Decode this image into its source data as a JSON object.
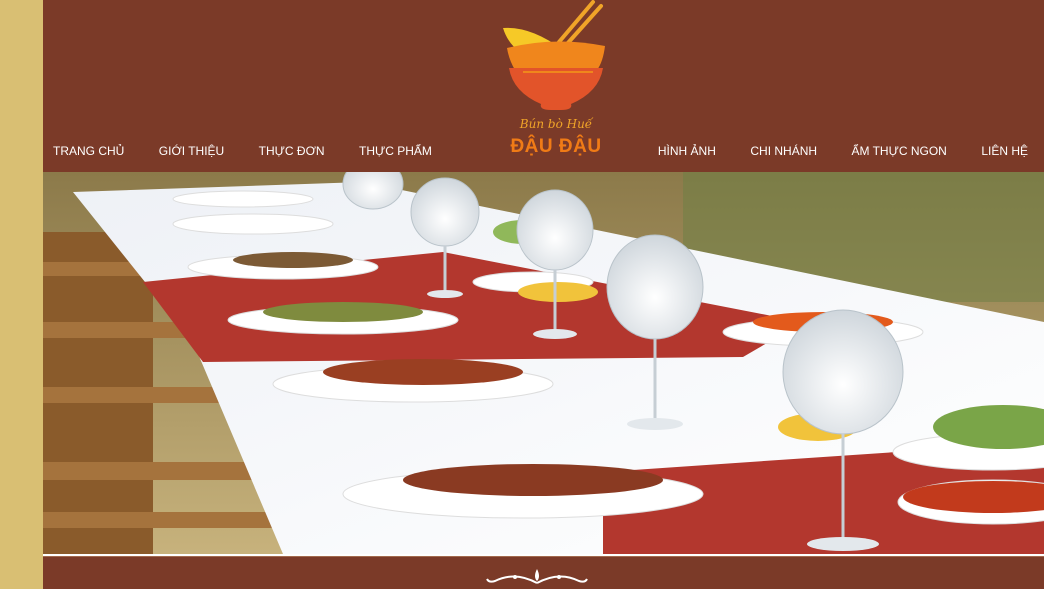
{
  "brand": {
    "script": "Bún bò Huế",
    "name": "ĐẬU ĐẬU",
    "logo_icon": "noodle-bowl-chopsticks-icon"
  },
  "nav": {
    "left": [
      "TRANG CHỦ",
      "GIỚI THIỆU",
      "THỰC ĐƠN",
      "THỰC PHẨM"
    ],
    "right": [
      "HÌNH ẢNH",
      "CHI NHÁNH",
      "ẨM THỰC NGON",
      "LIÊN HỆ"
    ]
  },
  "hero": {
    "image": "banquet-table-photo"
  },
  "footer": {
    "ornament": "flourish-ornament-icon"
  },
  "colors": {
    "background": "#d9bf73",
    "header": "#7b3a28",
    "brand_orange": "#f07b16",
    "brand_yellow": "#f0a428"
  }
}
